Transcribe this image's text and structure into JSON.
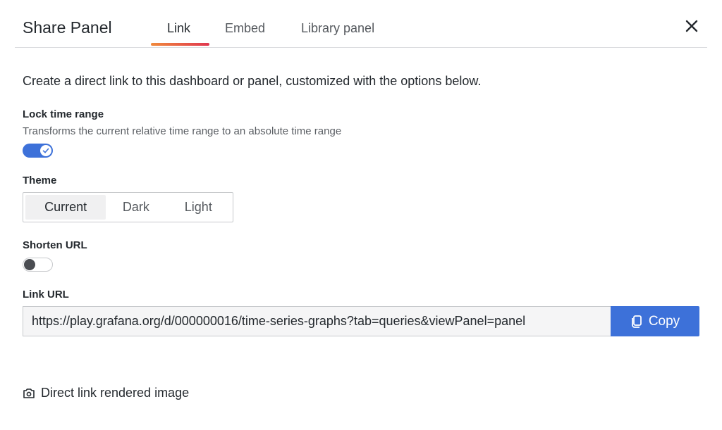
{
  "header": {
    "title": "Share Panel",
    "tabs": [
      {
        "label": "Link",
        "active": true
      },
      {
        "label": "Embed",
        "active": false
      },
      {
        "label": "Library panel",
        "active": false
      }
    ],
    "close_icon": "close-icon"
  },
  "content": {
    "description": "Create a direct link to this dashboard or panel, customized with the options below.",
    "lock_time_range": {
      "label": "Lock time range",
      "description": "Transforms the current relative time range to an absolute time range",
      "enabled": true
    },
    "theme": {
      "label": "Theme",
      "options": [
        "Current",
        "Dark",
        "Light"
      ],
      "selected": "Current"
    },
    "shorten_url": {
      "label": "Shorten URL",
      "enabled": false
    },
    "link_url": {
      "label": "Link URL",
      "value": "https://play.grafana.org/d/000000016/time-series-graphs?tab=queries&viewPanel=panel",
      "copy_label": "Copy"
    },
    "direct_link": {
      "label": "Direct link rendered image",
      "icon": "camera-icon"
    }
  },
  "colors": {
    "accent": "#3d71d9",
    "tab_gradient_start": "#f08a3c",
    "tab_gradient_end": "#e0364f"
  }
}
